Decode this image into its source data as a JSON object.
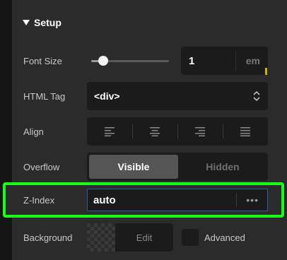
{
  "section": {
    "title": "Setup"
  },
  "font_size": {
    "label": "Font Size",
    "value": "1",
    "unit": "em",
    "slider_fraction": 0.15
  },
  "html_tag": {
    "label": "HTML Tag",
    "value": "<div>"
  },
  "align": {
    "label": "Align",
    "options": [
      "align-left-icon",
      "align-center-icon",
      "align-right-icon",
      "align-justify-icon"
    ]
  },
  "overflow": {
    "label": "Overflow",
    "options": [
      "Visible",
      "Hidden"
    ],
    "selected": "Visible"
  },
  "z_index": {
    "label": "Z-Index",
    "value": "auto",
    "more": "•••"
  },
  "background": {
    "label": "Background",
    "edit_label": "Edit",
    "advanced_label": "Advanced"
  },
  "colors": {
    "highlight": "#19ff19",
    "panel": "#2b2b2b",
    "field": "#1b1b1b"
  }
}
